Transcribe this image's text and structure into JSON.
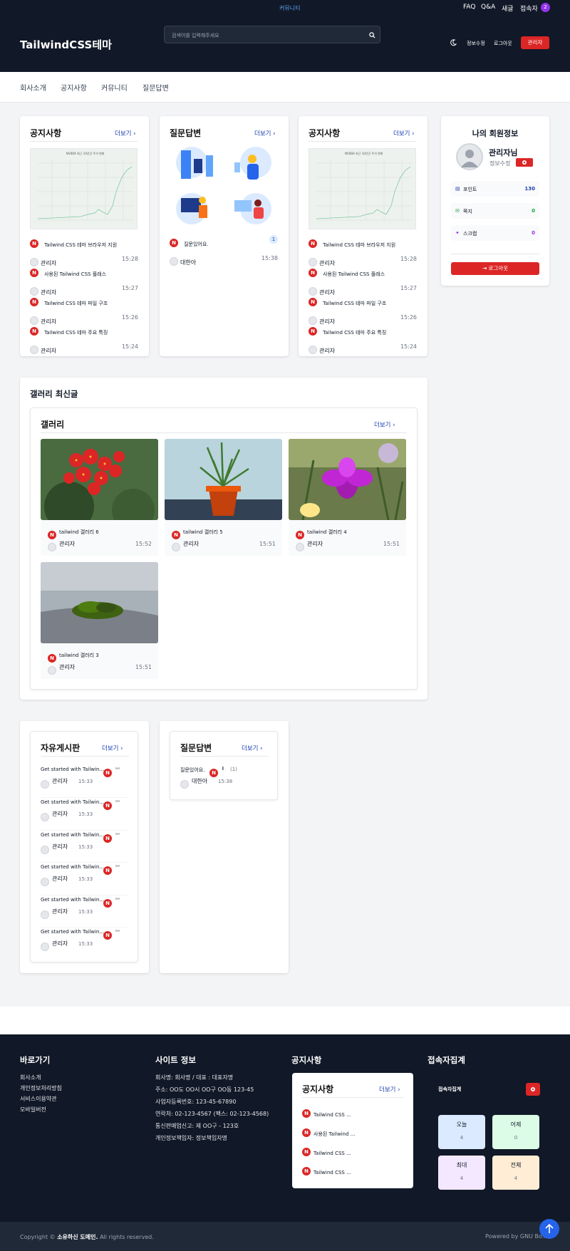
{
  "topbar": {
    "center_link": "커뮤니티",
    "links": [
      "FAQ",
      "Q&A",
      "새글",
      "접속자"
    ],
    "visitor_count": "2"
  },
  "header": {
    "logo": "TailwindCSS테마",
    "search_placeholder": "검색어를 입력해주세요",
    "links": [
      "정보수정",
      "로그아웃"
    ],
    "admin_button": "관리자"
  },
  "nav": {
    "items": [
      "회사소개",
      "공지사항",
      "커뮤니티",
      "질문답변"
    ]
  },
  "colors": {
    "brand_red": "#dc2626",
    "dark_bg": "#111827",
    "link_blue": "#1e40af",
    "accent_purple": "#9333ea"
  },
  "more_label": "더보기",
  "notice1": {
    "title": "공지사항",
    "chart_title": "NVIDIA 최근 10년간 주가 변화",
    "posts": [
      {
        "title": "Tailwind CSS 테마 브라우저 지원",
        "author": "관리자",
        "time": "15:28"
      },
      {
        "title": "사용된 Tailwind CSS 플래스",
        "author": "관리자",
        "time": "15:27"
      },
      {
        "title": "Tailwind CSS 테마 파일 구조",
        "author": "관리자",
        "time": "15:26"
      },
      {
        "title": "Tailwind CSS 테마 주요 특징",
        "author": "관리자",
        "time": "15:24"
      }
    ]
  },
  "qna1": {
    "title": "질문답변",
    "posts": [
      {
        "title": "질문있어요.",
        "count": "1",
        "author": "대한아",
        "time": "15:38"
      }
    ]
  },
  "notice2": {
    "title": "공지사항",
    "chart_title": "NVIDIA 최근 10년간 주가 변화",
    "posts": [
      {
        "title": "Tailwind CSS 테마 브라우저 지원",
        "author": "관리자",
        "time": "15:28"
      },
      {
        "title": "사용된 Tailwind CSS 플래스",
        "author": "관리자",
        "time": "15:27"
      },
      {
        "title": "Tailwind CSS 테마 파일 구조",
        "author": "관리자",
        "time": "15:26"
      },
      {
        "title": "Tailwind CSS 테마 주요 특징",
        "author": "관리자",
        "time": "15:24"
      }
    ]
  },
  "member": {
    "title": "나의 회원정보",
    "name": "관리자님",
    "edit": "정보수정",
    "rows": [
      {
        "label": "포인트",
        "value": "130"
      },
      {
        "label": "쪽지",
        "value": "0"
      },
      {
        "label": "스크랩",
        "value": "0"
      }
    ],
    "logout": "로그아웃"
  },
  "gallery_section": {
    "title": "갤러리 최신글",
    "inner_title": "갤러리",
    "items": [
      {
        "title": "tailwind 갤러리 6",
        "author": "관리자",
        "time": "15:52"
      },
      {
        "title": "tailwind 갤러리 5",
        "author": "관리자",
        "time": "15:51"
      },
      {
        "title": "tailwind 갤러리 4",
        "author": "관리자",
        "time": "15:51"
      },
      {
        "title": "tailwind 갤러리 3",
        "author": "관리자",
        "time": "15:51"
      }
    ]
  },
  "free": {
    "title": "자유게시판",
    "posts": [
      {
        "title": "Get started with Tailwin...",
        "author": "관리자",
        "time": "15:33"
      },
      {
        "title": "Get started with Tailwin...",
        "author": "관리자",
        "time": "15:33"
      },
      {
        "title": "Get started with Tailwin...",
        "author": "관리자",
        "time": "15:33"
      },
      {
        "title": "Get started with Tailwin...",
        "author": "관리자",
        "time": "15:33"
      },
      {
        "title": "Get started with Tailwin...",
        "author": "관리자",
        "time": "15:33"
      },
      {
        "title": "Get started with Tailwin...",
        "author": "관리자",
        "time": "15:33"
      }
    ]
  },
  "qna2": {
    "title": "질문답변",
    "post": {
      "title": "질문있어요.",
      "count": "(1)",
      "author": "대한아",
      "time": "15:38"
    }
  },
  "footer": {
    "col1_title": "바로가기",
    "col1_links": [
      "회사소개",
      "개인정보처리방침",
      "서비스이용약관",
      "모바일버전"
    ],
    "col2_title": "사이트 정보",
    "col2_lines": [
      "회사명: 회사명 / 대표 : 대표자명",
      "주소: OO도 OO시 OO구 OO동 123-45",
      "사업자등록번호: 123-45-67890",
      "연락처: 02-123-4567 (팩스: 02-123-4568)",
      "통신판매업신고: 제 OO구 - 123호",
      "개인정보책임자: 정보책임자명"
    ],
    "col3_title": "공지사항",
    "col3_inner": "공지사항",
    "col3_posts": [
      "Tailwind CSS ...",
      "사용된 Tailwind ...",
      "Tailwind CSS ...",
      "Tailwind CSS ..."
    ],
    "col4_title": "접속자집계",
    "col4_inner": "접속자집계",
    "stats": [
      {
        "label": "오늘",
        "value": "4"
      },
      {
        "label": "어제",
        "value": "0"
      },
      {
        "label": "최대",
        "value": "4"
      },
      {
        "label": "전체",
        "value": "4"
      }
    ],
    "copyright_pre": "Copyright ©",
    "copyright_name": "소유하신 도메인.",
    "copyright_post": "All rights reserved.",
    "powered": "Powered by GNU Bo..."
  }
}
